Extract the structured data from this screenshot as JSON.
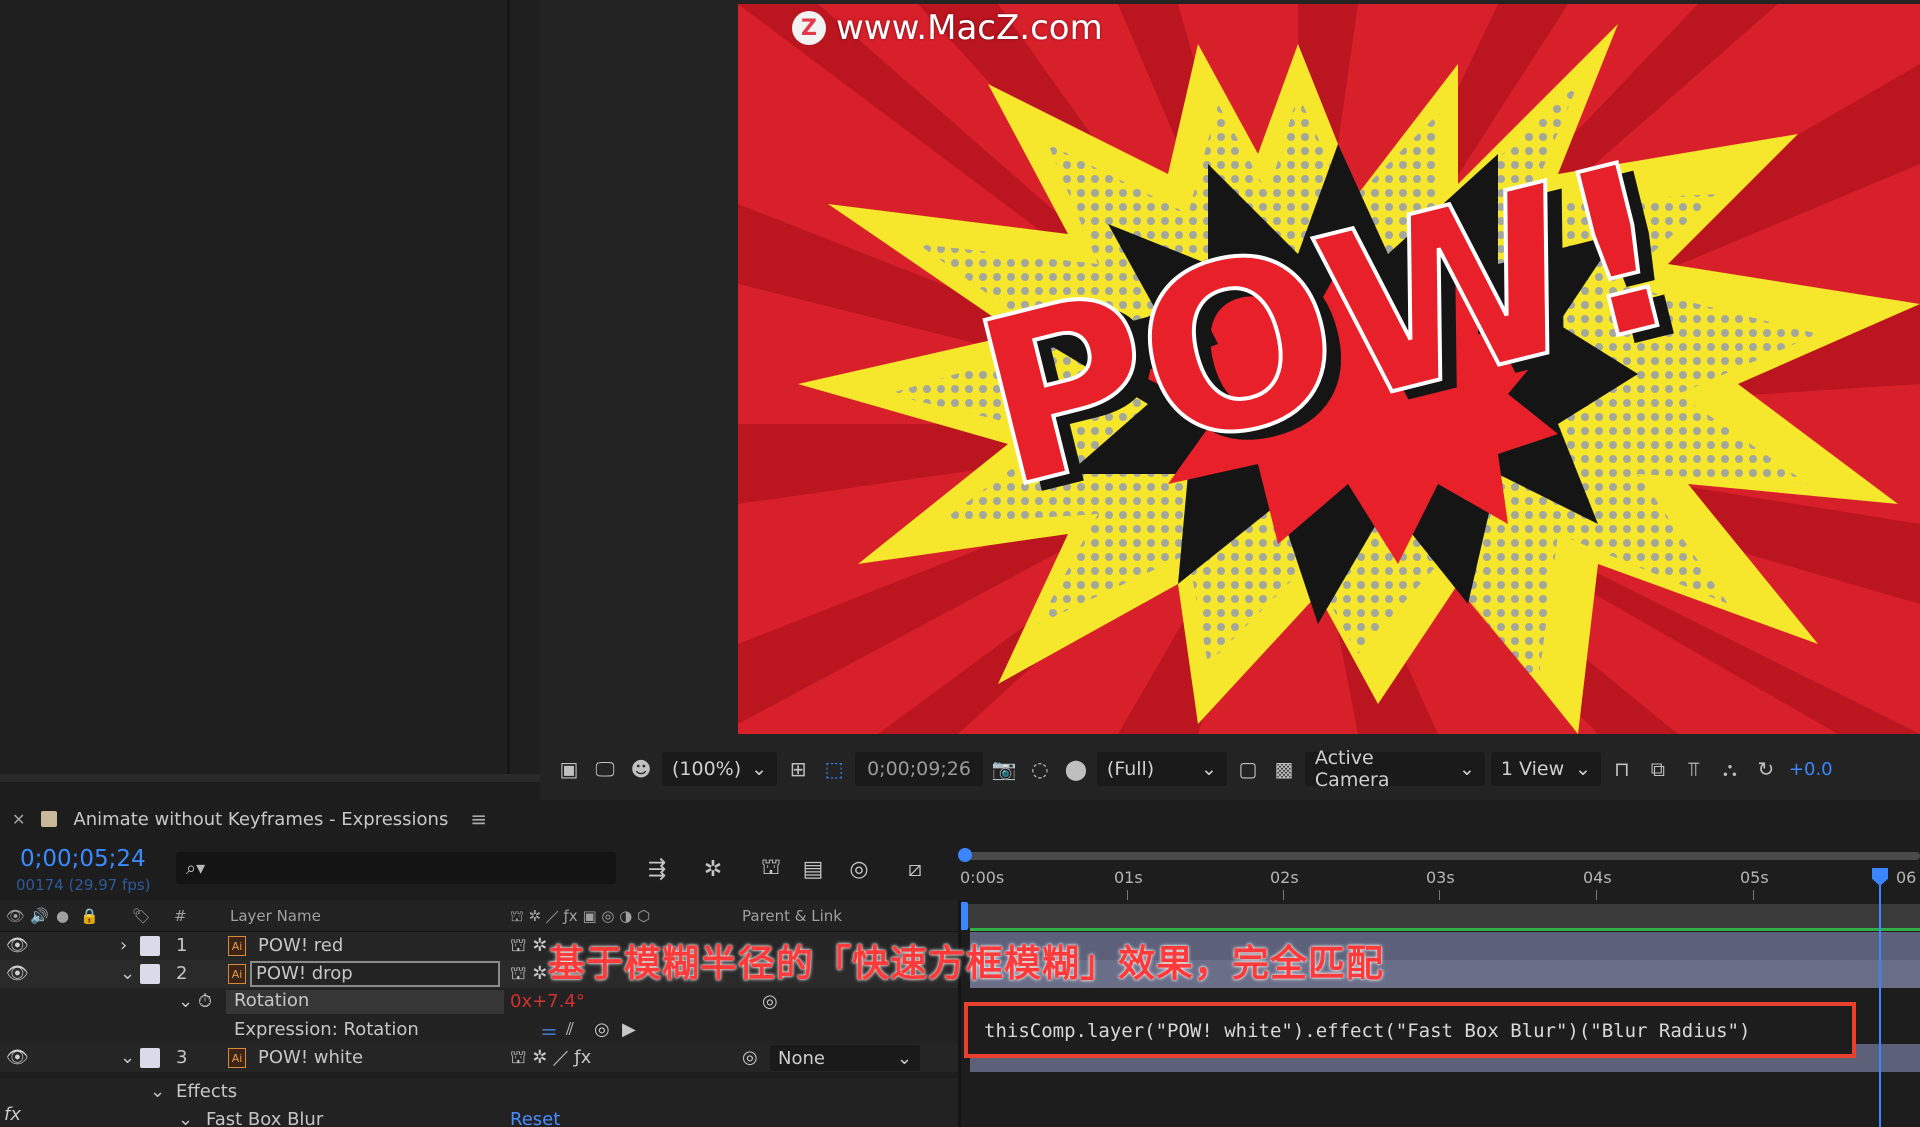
{
  "watermark": {
    "logo_letter": "Z",
    "text": "www.MacZ.com"
  },
  "composition": {
    "artwork": "POW! comic burst",
    "colors": {
      "background": "#d8202b",
      "burst": "#f6e72c",
      "outline": "#111111",
      "text": "#e8202a"
    }
  },
  "viewer_toolbar": {
    "zoom": "(100%)",
    "current_time": "0;00;09;26",
    "resolution": "(Full)",
    "camera": "Active Camera",
    "views": "1 View",
    "exposure_offset": "+0.0"
  },
  "timeline": {
    "tab_title": "Animate without Keyframes - Expressions",
    "timecode": "0;00;05;24",
    "frame_info": "00174 (29.97 fps)",
    "search_placeholder": "",
    "ruler_ticks": [
      "0:00s",
      "01s",
      "02s",
      "03s",
      "04s",
      "05s",
      "06"
    ],
    "columns": {
      "number": "#",
      "layer_name": "Layer Name",
      "parent_link": "Parent & Link"
    },
    "layers": [
      {
        "index": "1",
        "name": "POW! red"
      },
      {
        "index": "2",
        "name": "POW! drop",
        "property": "Rotation",
        "rotation_value": "0x+7.4°",
        "expression_label": "Expression: Rotation"
      },
      {
        "index": "3",
        "name": "POW! white",
        "parent": "None",
        "effects_label": "Effects",
        "effect_name": "Fast Box Blur",
        "reset_label": "Reset"
      }
    ],
    "expression": "thisComp.layer(\"POW! white\").effect(\"Fast Box Blur\")(\"Blur Radius\")"
  },
  "overlay_caption": "基于模糊半径的「快速方框模糊」效果，完全匹配"
}
